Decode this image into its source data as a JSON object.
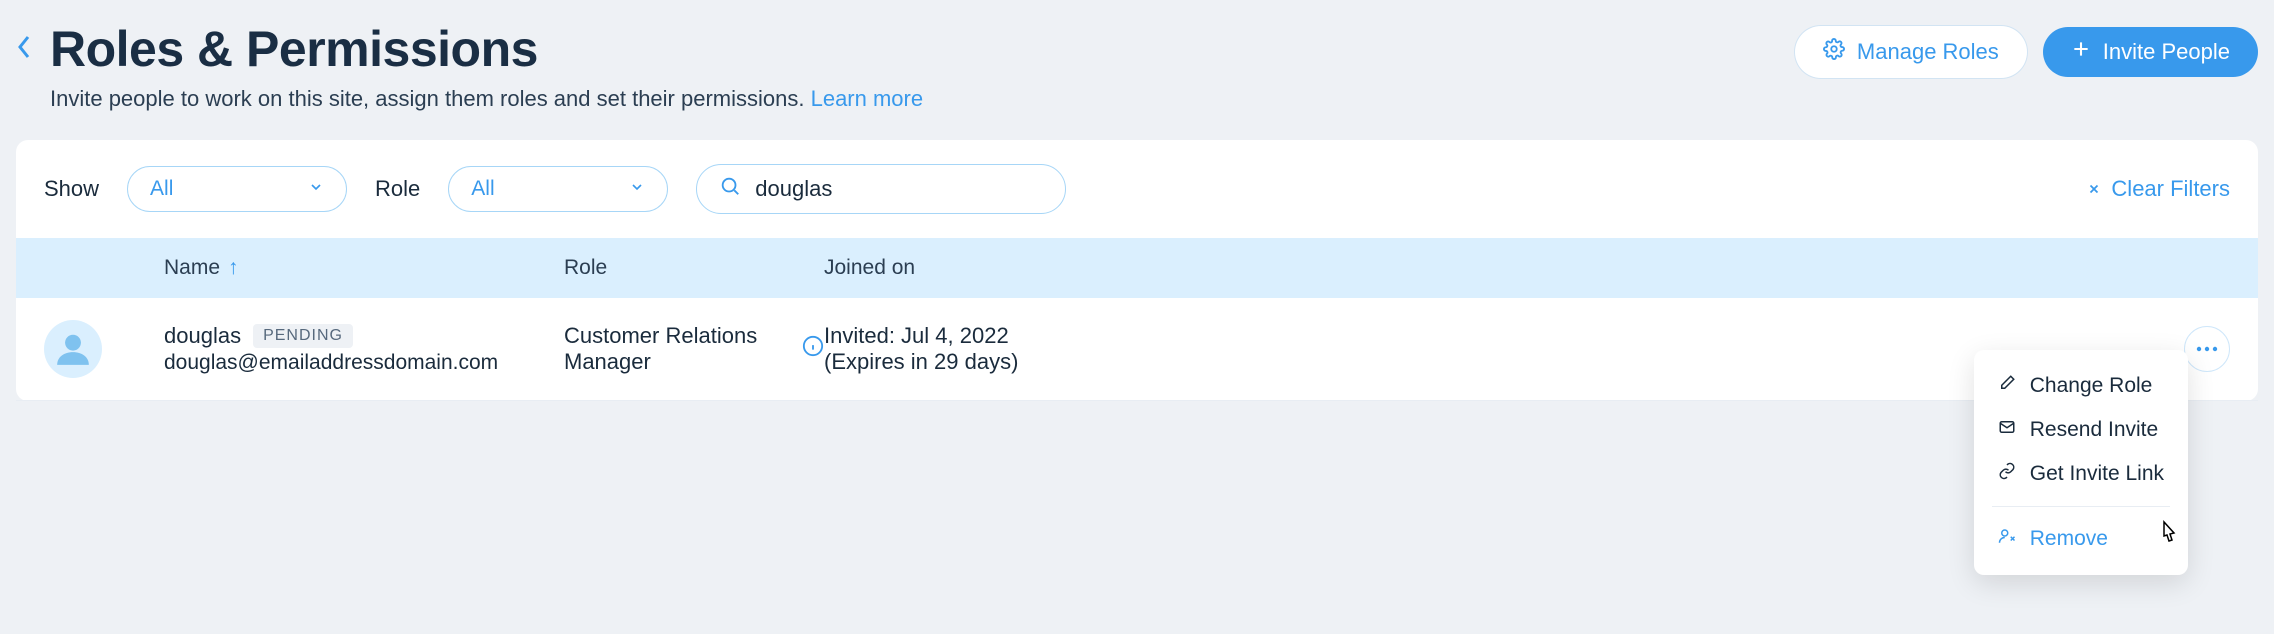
{
  "header": {
    "title": "Roles & Permissions",
    "subtitle_prefix": "Invite people to work on this site, assign them roles and set their permissions. ",
    "learn_more": "Learn more",
    "manage_roles": "Manage Roles",
    "invite_people": "Invite People"
  },
  "filters": {
    "show_label": "Show",
    "show_value": "All",
    "role_label": "Role",
    "role_value": "All",
    "search_value": "douglas",
    "clear": "Clear Filters"
  },
  "table": {
    "columns": {
      "name": "Name",
      "role": "Role",
      "joined": "Joined on"
    },
    "rows": [
      {
        "name": "douglas",
        "badge": "PENDING",
        "email": "douglas@emailaddressdomain.com",
        "role": "Customer Relations Manager",
        "joined_line1": "Invited: Jul 4, 2022",
        "joined_line2": "(Expires in 29 days)"
      }
    ]
  },
  "menu": {
    "change_role": "Change Role",
    "resend_invite": "Resend Invite",
    "get_invite_link": "Get Invite Link",
    "remove": "Remove"
  }
}
